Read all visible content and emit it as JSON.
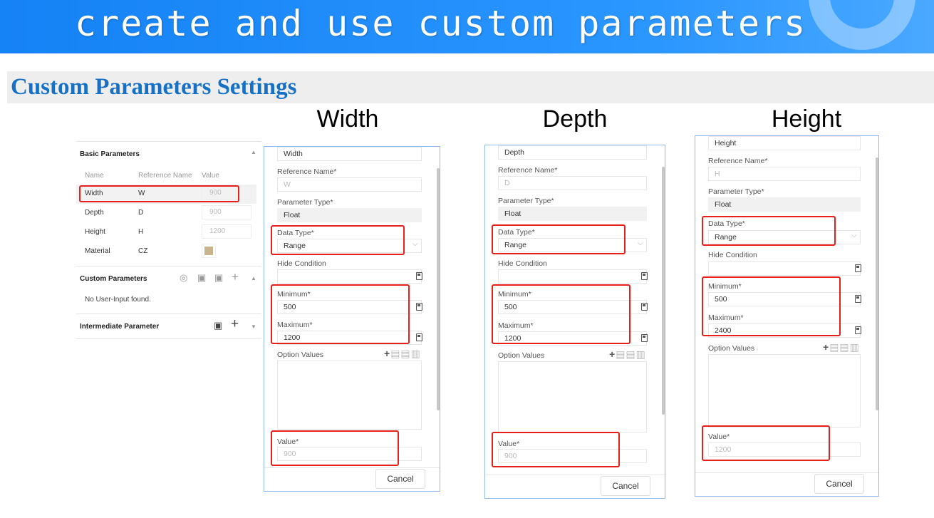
{
  "banner": {
    "title": "create and use custom parameters"
  },
  "section": {
    "title": "Custom Parameters Settings"
  },
  "sidebar": {
    "basic": {
      "title": "Basic Parameters",
      "columns": [
        "Name",
        "Reference Name",
        "Value"
      ],
      "rows": [
        {
          "name": "Width",
          "ref": "W",
          "value": "900"
        },
        {
          "name": "Depth",
          "ref": "D",
          "value": "900"
        },
        {
          "name": "Height",
          "ref": "H",
          "value": "1200"
        },
        {
          "name": "Material",
          "ref": "CZ",
          "value": ""
        }
      ]
    },
    "custom": {
      "title": "Custom Parameters",
      "empty": "No User-Input found."
    },
    "intermediate": {
      "title": "Intermediate Parameter"
    }
  },
  "panels": [
    {
      "heading": "Width",
      "name": "Width",
      "ref_label": "Reference Name*",
      "ref": "W",
      "ptype_label": "Parameter Type*",
      "ptype": "Float",
      "dtype_label": "Data Type*",
      "dtype": "Range",
      "hide_label": "Hide Condition",
      "min_label": "Minimum*",
      "min": "500",
      "max_label": "Maximum*",
      "max": "1200",
      "options_label": "Option Values",
      "value_label": "Value*",
      "value": "900",
      "cancel": "Cancel"
    },
    {
      "heading": "Depth",
      "name": "Depth",
      "ref_label": "Reference Name*",
      "ref": "D",
      "ptype_label": "Parameter Type*",
      "ptype": "Float",
      "dtype_label": "Data Type*",
      "dtype": "Range",
      "hide_label": "Hide Condition",
      "min_label": "Minimum*",
      "min": "500",
      "max_label": "Maximum*",
      "max": "1200",
      "options_label": "Option Values",
      "value_label": "Value*",
      "value": "900",
      "cancel": "Cancel"
    },
    {
      "heading": "Height",
      "name": "Height",
      "ref_label": "Reference Name*",
      "ref": "H",
      "ptype_label": "Parameter Type*",
      "ptype": "Float",
      "dtype_label": "Data Type*",
      "dtype": "Range",
      "hide_label": "Hide Condition",
      "min_label": "Minimum*",
      "min": "500",
      "max_label": "Maximum*",
      "max": "2400",
      "options_label": "Option Values",
      "value_label": "Value*",
      "value": "1200",
      "cancel": "Cancel"
    }
  ],
  "colors": {
    "banner": "#1a8cff",
    "section_title": "#1670c6",
    "highlight": "#e8201c"
  }
}
